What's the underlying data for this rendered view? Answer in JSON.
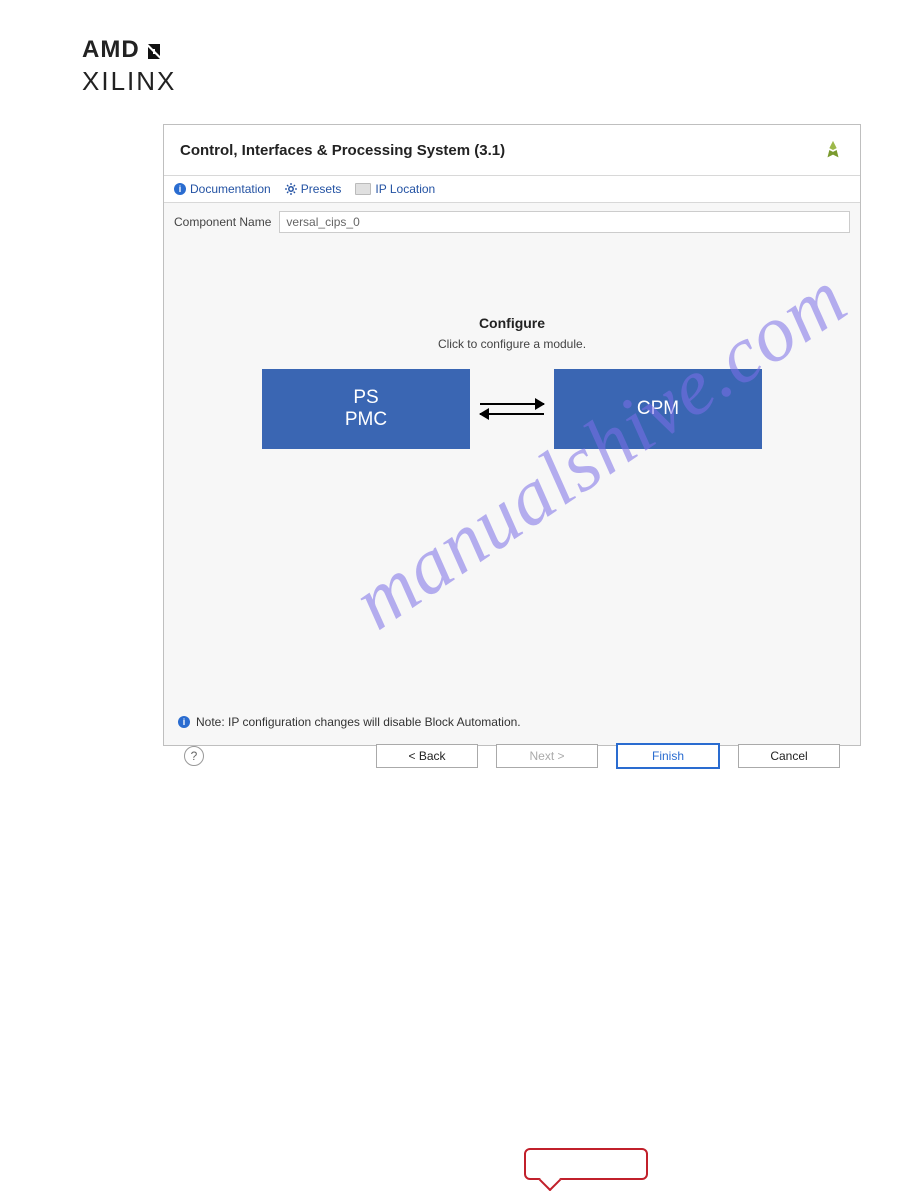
{
  "logo": {
    "amd": "AMD",
    "xilinx": "XILINX"
  },
  "dialog": {
    "title": "Control, Interfaces & Processing System (3.1)",
    "links": {
      "documentation": "Documentation",
      "presets": "Presets",
      "ip_location": "IP Location"
    },
    "component_label": "Component Name",
    "component_value": "versal_cips_0",
    "configure": {
      "title": "Configure",
      "subtitle": "Click to configure a module."
    },
    "blocks": {
      "ps_line1": "PS",
      "ps_line2": "PMC",
      "cpm": "CPM"
    },
    "note": "Note: IP configuration changes will disable Block Automation.",
    "buttons": {
      "back": "< Back",
      "next": "Next >",
      "finish": "Finish",
      "cancel": "Cancel"
    },
    "help": "?"
  },
  "watermark": "manualshive.com"
}
